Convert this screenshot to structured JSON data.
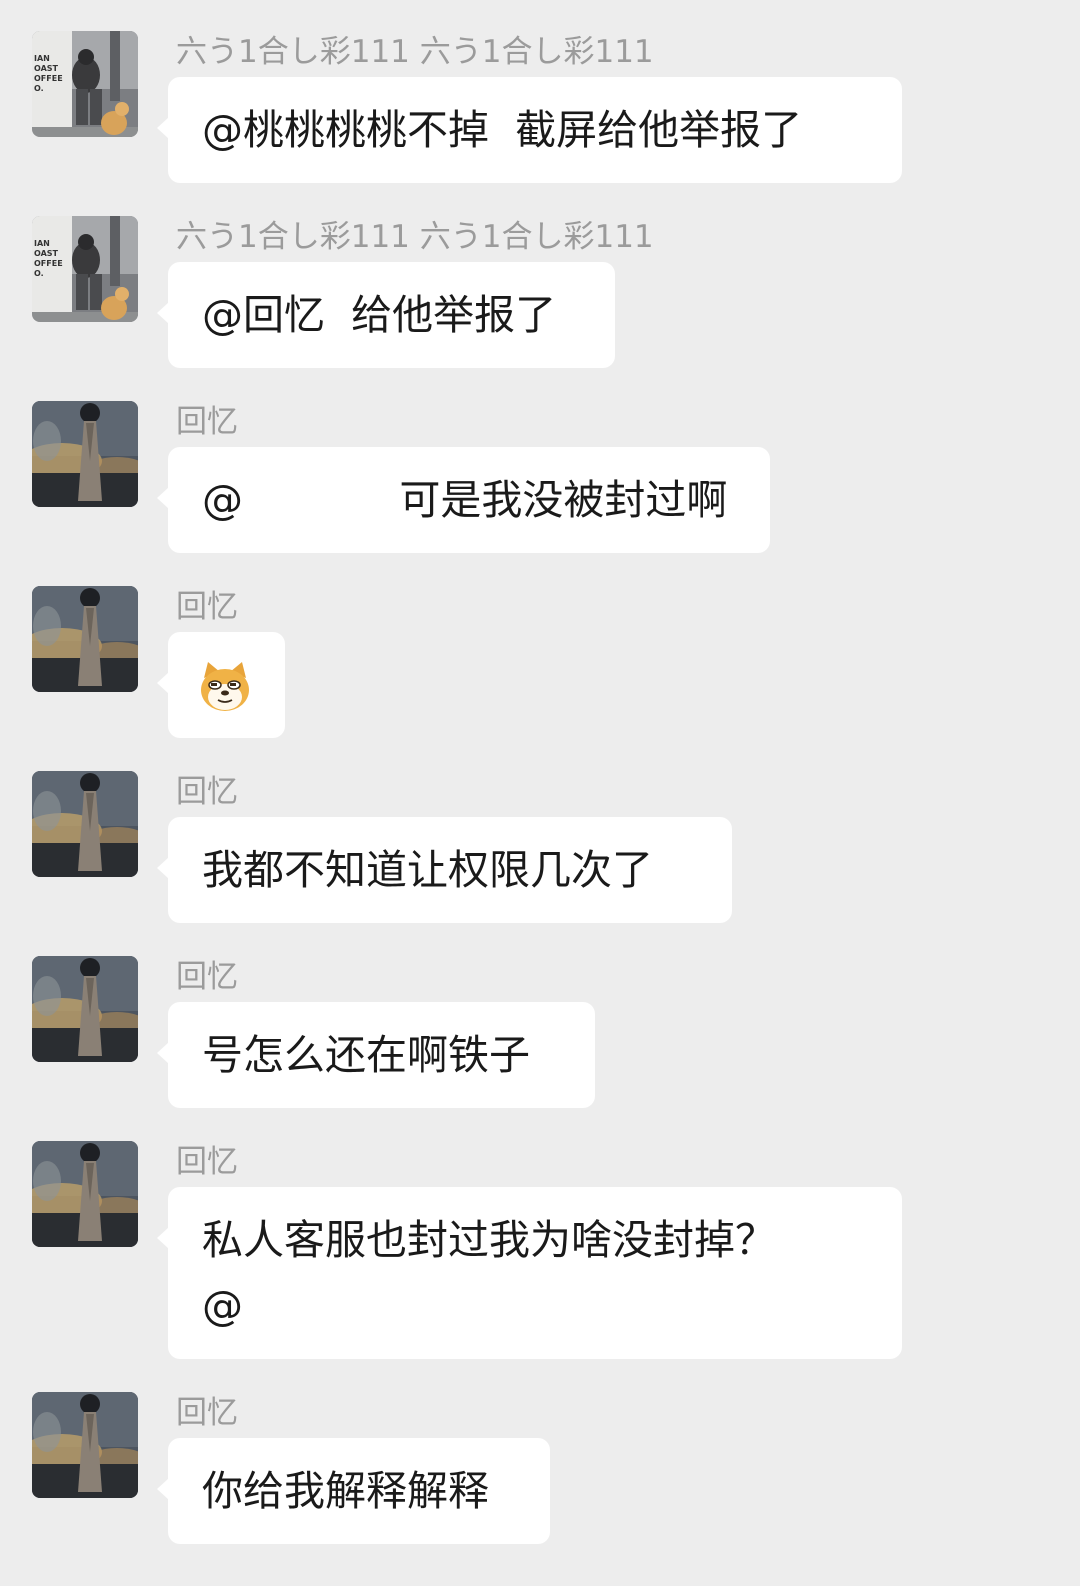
{
  "messages": [
    {
      "sender": "六う1合し彩111 六う1合し彩111",
      "lines": [
        "@桃桃桃桃不掉  截屏给他举报了"
      ]
    },
    {
      "sender": "六う1合し彩111 六う1合し彩111",
      "lines": [
        "@回忆  给他举报了"
      ]
    },
    {
      "sender": "回忆",
      "lines": [
        "@            可是我没被封过啊"
      ]
    },
    {
      "sender": "回忆",
      "emoji": "doge-sticker-icon"
    },
    {
      "sender": "回忆",
      "lines": [
        "我都不知道让权限几次了"
      ]
    },
    {
      "sender": "回忆",
      "lines": [
        "号怎么还在啊铁子"
      ]
    },
    {
      "sender": "回忆",
      "lines": [
        "私人客服也封过我为啥没封掉？",
        "@"
      ]
    },
    {
      "sender": "回忆",
      "lines": [
        "你给我解释解释"
      ]
    }
  ],
  "colors": {
    "background": "#ededed",
    "bubble": "#ffffff",
    "sender_text": "#9b9b9b",
    "message_text": "#1a1a1a"
  }
}
